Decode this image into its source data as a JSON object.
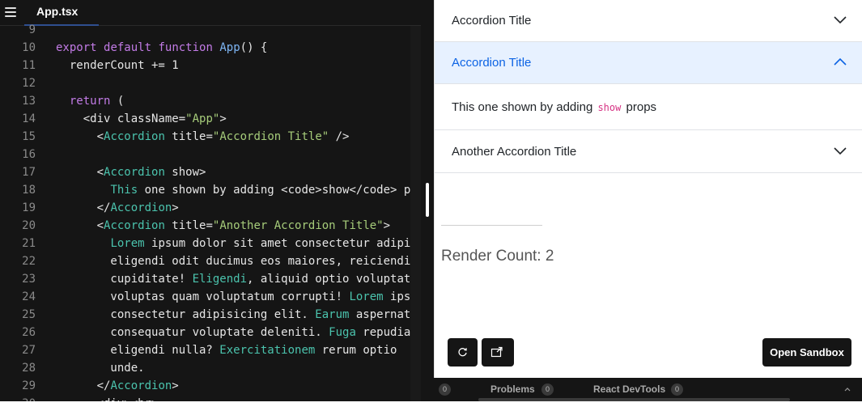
{
  "editor": {
    "file_tab": "App.tsx",
    "lines": [
      {
        "n": "9",
        "html": ""
      },
      {
        "n": "10",
        "html": "<span class=\"kw\">export</span> <span class=\"kw\">default</span> <span class=\"kw\">function</span> <span class=\"fn\">App</span>() {"
      },
      {
        "n": "11",
        "html": "  renderCount += 1"
      },
      {
        "n": "12",
        "html": ""
      },
      {
        "n": "13",
        "html": "  <span class=\"kw\">return</span> ("
      },
      {
        "n": "14",
        "html": "    &lt;div className=<span class=\"str\">\"App\"</span>&gt;"
      },
      {
        "n": "15",
        "html": "      &lt;<span class=\"tag\">Accordion</span> title=<span class=\"str\">\"Accordion Title\"</span> /&gt;"
      },
      {
        "n": "16",
        "html": ""
      },
      {
        "n": "17",
        "html": "      &lt;<span class=\"tag\">Accordion</span> show&gt;"
      },
      {
        "n": "18",
        "html": "        <span class=\"tag\">This</span> one shown by adding &lt;code&gt;show&lt;/code&gt; props"
      },
      {
        "n": "19",
        "html": "      &lt;/<span class=\"tag\">Accordion</span>&gt;"
      },
      {
        "n": "20",
        "html": "      &lt;<span class=\"tag\">Accordion</span> title=<span class=\"str\">\"Another Accordion Title\"</span>&gt;"
      },
      {
        "n": "21",
        "html": "        <span class=\"tag\">Lorem</span> ipsum dolor sit amet consectetur adipisicing elit."
      },
      {
        "n": "22",
        "html": "        eligendi odit ducimus eos maiores, reiciendis"
      },
      {
        "n": "23",
        "html": "        cupiditate! <span class=\"tag\">Eligendi</span>, aliquid optio voluptatem"
      },
      {
        "n": "24",
        "html": "        voluptas quam voluptatum corrupti! <span class=\"tag\">Lorem</span> ipsum"
      },
      {
        "n": "25",
        "html": "        consectetur adipisicing elit. <span class=\"tag\">Earum</span> aspernatur"
      },
      {
        "n": "26",
        "html": "        consequatur voluptate deleniti. <span class=\"tag\">Fuga</span> repudiandae"
      },
      {
        "n": "27",
        "html": "        eligendi nulla? <span class=\"tag\">Exercitationem</span> rerum optio"
      },
      {
        "n": "28",
        "html": "        unde."
      },
      {
        "n": "29",
        "html": "      &lt;/<span class=\"tag\">Accordion</span>&gt;"
      },
      {
        "n": "30",
        "html": "      &lt;div&gt;&lt;hr&gt;"
      }
    ]
  },
  "preview": {
    "accordion": [
      {
        "title": "Accordion Title",
        "expanded": false
      },
      {
        "title": "Accordion Title",
        "expanded": true,
        "body_before": "This one shown by adding",
        "body_code": "show",
        "body_after": "props"
      },
      {
        "title": "Another Accordion Title",
        "expanded": false
      }
    ],
    "render_count": "Render Count: 2",
    "open_sandbox": "Open Sandbox",
    "refresh_icon": "refresh-icon",
    "external_icon": "open-external-icon"
  },
  "console": {
    "badge_first": "0",
    "problems_label": "Problems",
    "problems_count": "0",
    "devtools_label": "React DevTools",
    "devtools_count": "0"
  },
  "colors": {
    "editor_bg": "#151515",
    "keyword": "#c27be6",
    "component": "#4bc3ad",
    "string": "#a6cc7a",
    "accordion_active_bg": "#e7f1ff",
    "accordion_active_text": "#0c63e4"
  }
}
